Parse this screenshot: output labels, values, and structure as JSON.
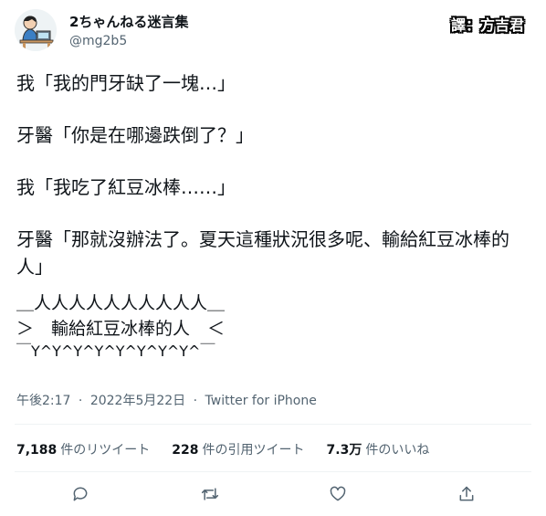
{
  "user": {
    "display_name": "2ちゃんねる迷言集",
    "handle": "@mg2b5",
    "avatar_icon": "person-at-desk-icon"
  },
  "translator_badge": {
    "label": "譯：方吉君"
  },
  "tweet": {
    "paragraphs": [
      "我「我的門牙缺了一塊…」",
      "牙醫「你是在哪邊跌倒了？」",
      "我「我吃了紅豆冰棒……」",
      "牙醫「那就沒辦法了。夏天這種狀況很多呢、輸給紅豆冰棒的人」"
    ],
    "ascii_art": {
      "top": "＿人人人人人人人人人人＿",
      "middle": "＞　輸給紅豆冰棒的人　＜",
      "bottom": "￣Y^Y^Y^Y^Y^Y^Y^Y^￣"
    }
  },
  "meta": {
    "time": "午後2:17",
    "date": "2022年5月22日",
    "source": "Twitter for iPhone",
    "separator": "·"
  },
  "stats": {
    "retweets_count": "7,188",
    "retweets_label": "件のリツイート",
    "quotes_count": "228",
    "quotes_label": "件の引用ツイート",
    "likes_count": "7.3万",
    "likes_label": "件のいいね"
  },
  "actions": [
    "reply-icon",
    "retweet-icon",
    "like-icon",
    "share-icon"
  ]
}
